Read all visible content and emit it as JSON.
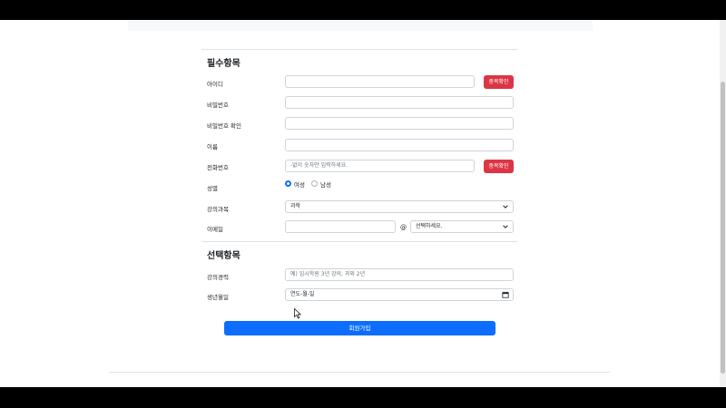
{
  "required_section": {
    "title": "필수항목"
  },
  "optional_section": {
    "title": "선택항목"
  },
  "fields": {
    "user_id": {
      "label": "아이디",
      "value": ""
    },
    "password": {
      "label": "비밀번호",
      "value": ""
    },
    "password_confirm": {
      "label": "비밀번호 확인",
      "value": ""
    },
    "name": {
      "label": "이름",
      "value": ""
    },
    "phone": {
      "label": "전화번호",
      "placeholder": "-없이 숫자만 입력하세요."
    },
    "gender": {
      "label": "성별",
      "options": [
        "여성",
        "남성"
      ],
      "selected": "여성"
    },
    "subject": {
      "label": "강의과목",
      "value": "과학"
    },
    "email": {
      "label": "이메일",
      "value": "",
      "domain_value": "선택하세요."
    },
    "career": {
      "label": "강의경력",
      "placeholder": "예) 입시학원 3년 강의, 과외 2년"
    },
    "birthdate": {
      "label": "생년월일",
      "placeholder": "연도-월-일"
    }
  },
  "buttons": {
    "id_check": "중복확인",
    "phone_check": "중복확인",
    "submit": "회원가입"
  },
  "email_separator": "@",
  "colors": {
    "primary": "#0d6efd",
    "danger": "#dc3545"
  }
}
